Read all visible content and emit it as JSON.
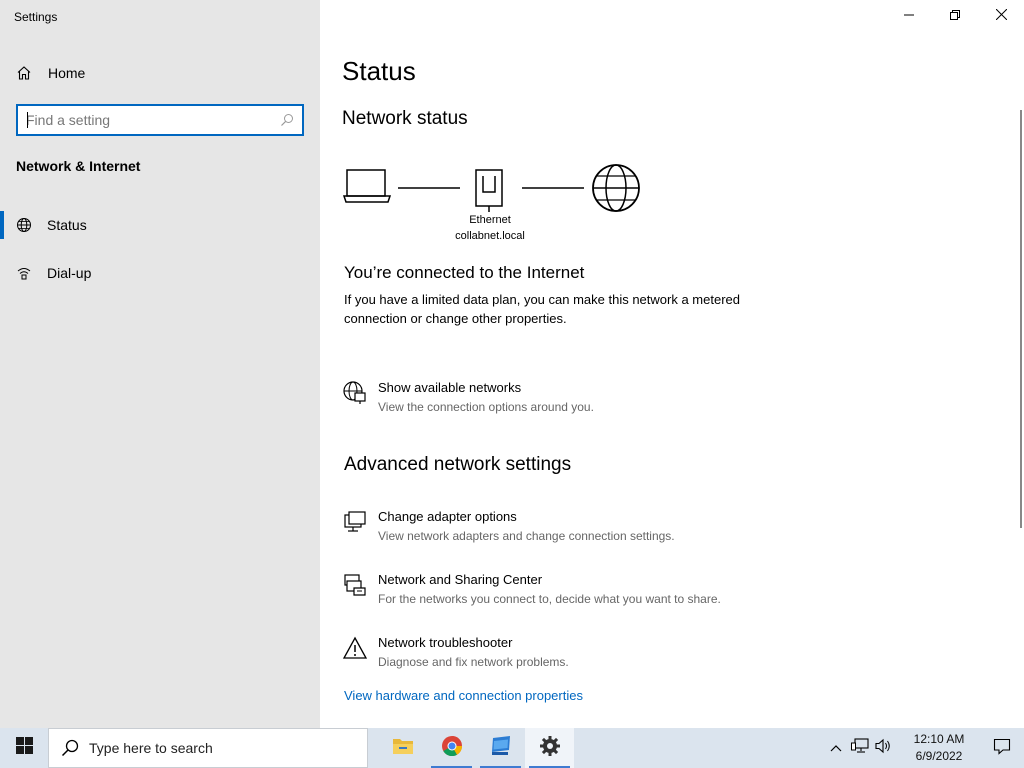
{
  "window": {
    "title": "Settings",
    "controls": {
      "minimize": "minimize-icon",
      "restore": "restore-icon",
      "close": "close-icon"
    }
  },
  "sidebar": {
    "home_label": "Home",
    "search": {
      "placeholder": "Find a setting",
      "value": ""
    },
    "section_title": "Network & Internet",
    "items": [
      {
        "label": "Status",
        "icon": "globe-network-icon",
        "selected": true
      },
      {
        "label": "Dial-up",
        "icon": "dialup-icon",
        "selected": false
      }
    ]
  },
  "main": {
    "title": "Status",
    "network_status_heading": "Network status",
    "diagram": {
      "adapter_name": "Ethernet",
      "network_name": "collabnet.local"
    },
    "connected_title": "You’re connected to the Internet",
    "connected_desc": "If you have a limited data plan, you can make this network a metered connection or change other properties.",
    "show_networks": {
      "title": "Show available networks",
      "desc": "View the connection options around you."
    },
    "advanced_heading": "Advanced network settings",
    "advanced_items": [
      {
        "title": "Change adapter options",
        "desc": "View network adapters and change connection settings.",
        "icon": "adapter-icon"
      },
      {
        "title": "Network and Sharing Center",
        "desc": "For the networks you connect to, decide what you want to share.",
        "icon": "sharing-center-icon"
      },
      {
        "title": "Network troubleshooter",
        "desc": "Diagnose and fix network problems.",
        "icon": "warning-icon"
      }
    ],
    "hardware_link": "View hardware and connection properties"
  },
  "taskbar": {
    "search_placeholder": "Type here to search",
    "apps": [
      "file-explorer-icon",
      "chrome-icon",
      "app-window-icon",
      "settings-gear-icon"
    ],
    "clock": {
      "time": "12:10 AM",
      "date": "6/9/2022"
    }
  },
  "colors": {
    "accent": "#0067c0",
    "sidebar_bg": "#e6e6e6",
    "taskbar_bg": "#dbe4ee"
  }
}
